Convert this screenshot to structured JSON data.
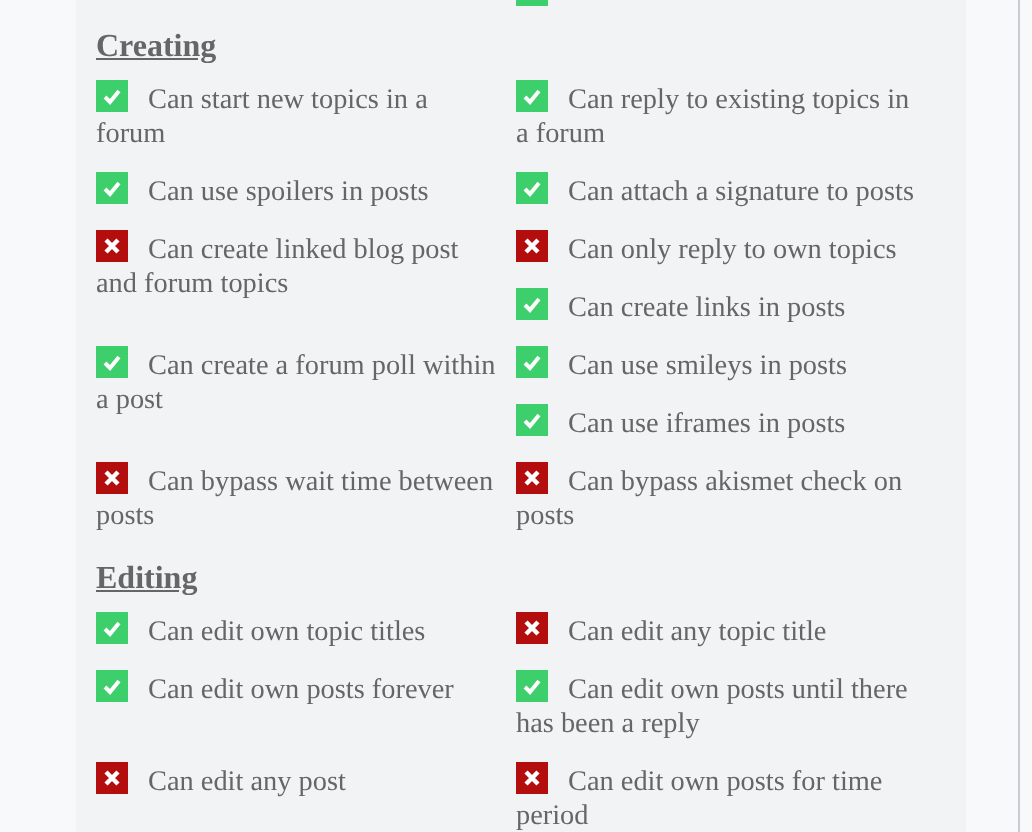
{
  "cut_icons": [
    {
      "allowed": true
    }
  ],
  "sections": [
    {
      "title": "Creating",
      "rows": [
        {
          "left": [
            {
              "text": "Can start new topics in a forum",
              "allowed": true
            }
          ],
          "right": [
            {
              "text": "Can reply to existing topics in a forum",
              "allowed": true
            }
          ]
        },
        {
          "left": [
            {
              "text": "Can use spoilers in posts",
              "allowed": true
            }
          ],
          "right": [
            {
              "text": "Can attach a signature to posts",
              "allowed": true
            }
          ]
        },
        {
          "left": [
            {
              "text": "Can create linked blog post and forum topics",
              "allowed": false
            }
          ],
          "right": [
            {
              "text": "Can only reply to own topics",
              "allowed": false
            },
            {
              "text": "Can create links in posts",
              "allowed": true
            }
          ]
        },
        {
          "left": [
            {
              "text": "Can create a forum poll within a post",
              "allowed": true
            }
          ],
          "right": [
            {
              "text": "Can use smileys in posts",
              "allowed": true
            },
            {
              "text": "Can use iframes in posts",
              "allowed": true
            }
          ]
        },
        {
          "left": [
            {
              "text": "Can bypass wait time between posts",
              "allowed": false
            }
          ],
          "right": [
            {
              "text": "Can bypass akismet check on posts",
              "allowed": false
            }
          ]
        }
      ]
    },
    {
      "title": "Editing",
      "rows": [
        {
          "left": [
            {
              "text": "Can edit own topic titles",
              "allowed": true
            }
          ],
          "right": [
            {
              "text": "Can edit any topic title",
              "allowed": false
            }
          ]
        },
        {
          "left": [
            {
              "text": "Can edit own posts forever",
              "allowed": true
            }
          ],
          "right": [
            {
              "text": "Can edit own posts until there has been a reply",
              "allowed": true
            }
          ]
        },
        {
          "left": [
            {
              "text": "Can edit any post",
              "allowed": false
            }
          ],
          "right": [
            {
              "text": "Can edit own posts for time period",
              "allowed": false
            }
          ]
        }
      ]
    }
  ]
}
